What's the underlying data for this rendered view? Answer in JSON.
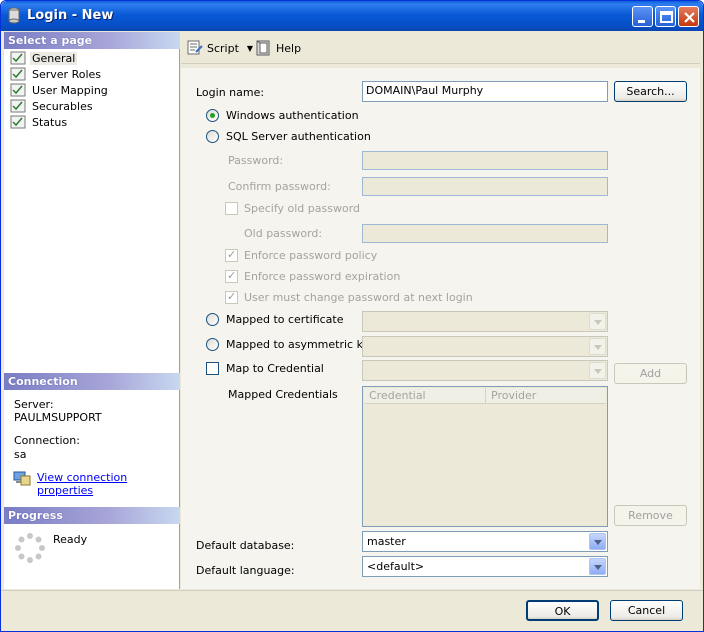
{
  "window": {
    "title": "Login - New"
  },
  "left_panel": {
    "select_page_header": "Select a page",
    "pages": [
      {
        "label": "General",
        "selected": true
      },
      {
        "label": "Server Roles",
        "selected": false
      },
      {
        "label": "User Mapping",
        "selected": false
      },
      {
        "label": "Securables",
        "selected": false
      },
      {
        "label": "Status",
        "selected": false
      }
    ],
    "connection_header": "Connection",
    "server_label": "Server:",
    "server_value": "PAULMSUPPORT",
    "connection_label": "Connection:",
    "connection_value": "sa",
    "view_connection_link": "View connection properties",
    "progress_header": "Progress",
    "progress_status": "Ready"
  },
  "toolbar": {
    "script_label": "Script",
    "help_label": "Help"
  },
  "general": {
    "login_name_label": "Login name:",
    "login_name_value": "DOMAIN\\Paul Murphy",
    "search_button": "Search...",
    "windows_auth_label": "Windows authentication",
    "windows_auth_selected": true,
    "sql_auth_label": "SQL Server authentication",
    "password_label": "Password:",
    "confirm_password_label": "Confirm password:",
    "specify_old_password_label": "Specify old password",
    "old_password_label": "Old password:",
    "enforce_policy_label": "Enforce password policy",
    "enforce_expiration_label": "Enforce password expiration",
    "must_change_label": "User must change password at next login",
    "mapped_certificate_label": "Mapped to certificate",
    "mapped_asym_key_label": "Mapped to asymmetric key",
    "map_credential_label": "Map to Credential",
    "add_button": "Add",
    "mapped_credentials_label": "Mapped Credentials",
    "credentials_columns": [
      "Credential",
      "Provider"
    ],
    "remove_button": "Remove",
    "default_database_label": "Default database:",
    "default_database_value": "master",
    "default_language_label": "Default language:",
    "default_language_value": "<default>"
  },
  "footer": {
    "ok_button": "OK",
    "cancel_button": "Cancel"
  },
  "colors": {
    "titlebar": "#0a5ad6",
    "radio_dot": "#21a121",
    "link": "#0000ff",
    "section_header": "#7a7dc4"
  }
}
